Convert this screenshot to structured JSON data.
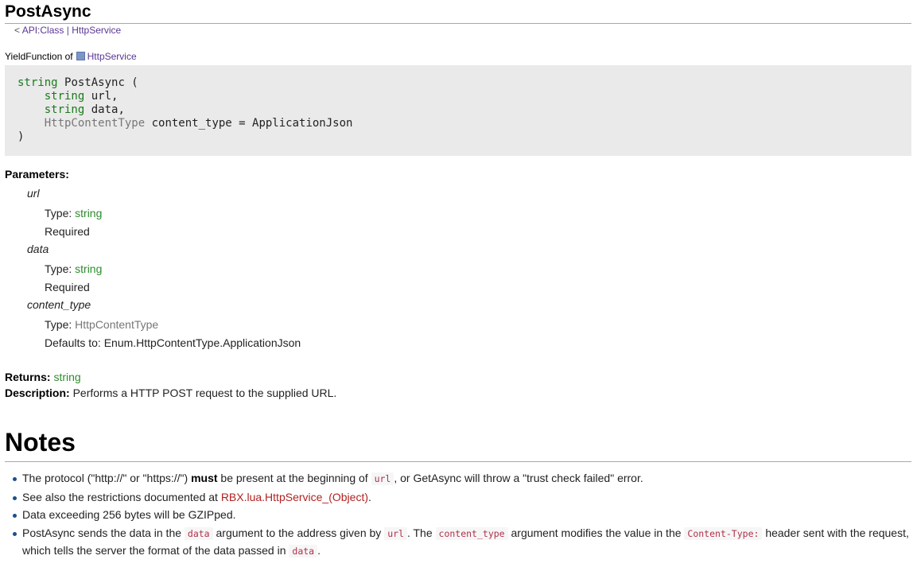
{
  "page": {
    "title": "PostAsync",
    "breadcrumb": {
      "prefix": "<",
      "class_link": "API:Class",
      "sep": "|",
      "service_link": "HttpService"
    },
    "yield_label": "YieldFunction of",
    "yield_class": "HttpService"
  },
  "signature": {
    "ret_type": "string",
    "name": "PostAsync (",
    "params": [
      {
        "type": "string",
        "rest": "url,"
      },
      {
        "type": "string",
        "rest": "data,"
      },
      {
        "type": "HttpContentType",
        "rest": "content_type = ApplicationJson"
      }
    ],
    "close": ")"
  },
  "parameters": {
    "heading": "Parameters:",
    "items": [
      {
        "name": "url",
        "type_label": "Type:",
        "type": "string",
        "extra": "Required"
      },
      {
        "name": "data",
        "type_label": "Type:",
        "type": "string",
        "extra": "Required"
      },
      {
        "name": "content_type",
        "type_label": "Type:",
        "type": "HttpContentType",
        "extra": "Defaults to: Enum.HttpContentType.ApplicationJson"
      }
    ]
  },
  "returns": {
    "label": "Returns:",
    "value": "string"
  },
  "description": {
    "label": "Description:",
    "text": "Performs a HTTP POST request to the supplied URL."
  },
  "notes": {
    "heading": "Notes",
    "n1": {
      "a": "The protocol (\"http://\" or \"https://\")",
      "b": "must",
      "c": "be present at the beginning of",
      "code": "url",
      "d": ", or GetAsync will throw a \"trust check failed\" error."
    },
    "n2": {
      "a": "See also the restrictions documented at",
      "link": "RBX.lua.HttpService_(Object)",
      "b": "."
    },
    "n3": {
      "a": "Data exceeding 256 bytes will be GZIPped."
    },
    "n4": {
      "a": "PostAsync sends the data in the",
      "code1": "data",
      "b": "argument to the address given by",
      "code2": "url",
      "c": ". The",
      "code3": "content_type",
      "d": "argument modifies the value in the",
      "code4": "Content-Type:",
      "e": "header sent with the request, which tells the server the format of the data passed in",
      "code5": "data",
      "f": "."
    }
  },
  "colors": {
    "type_green": "#2e8b2e",
    "link_purple": "#5a3696",
    "code_red": "#b0304a",
    "red_link": "#b22222"
  }
}
